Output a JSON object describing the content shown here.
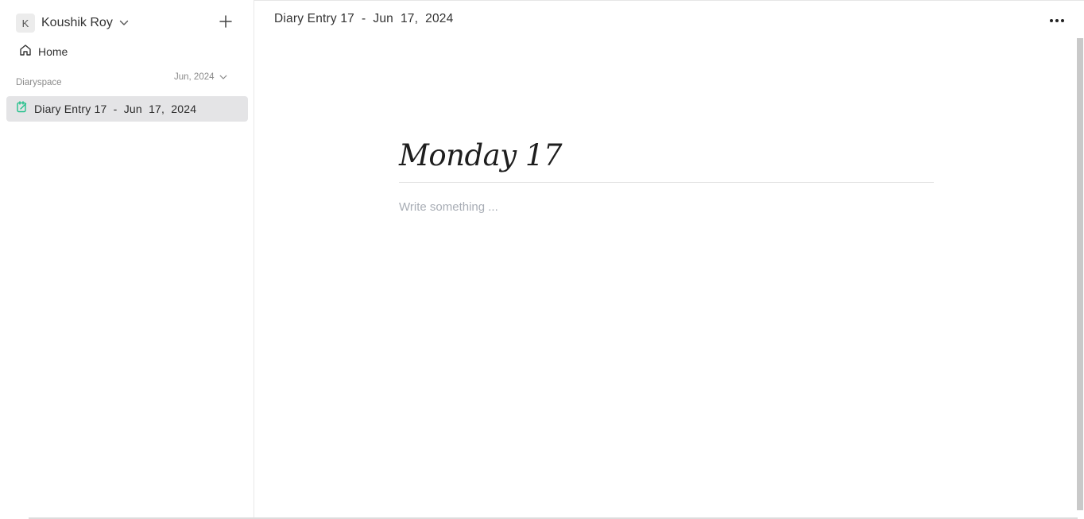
{
  "sidebar": {
    "user": {
      "initial": "K",
      "name": "Koushik Roy"
    },
    "home_label": "Home",
    "section_label": "Diaryspace",
    "month_filter": "Jun, 2024",
    "entries": [
      {
        "label": "Diary Entry 17  -  Jun  17,  2024",
        "icon": "diary-entry-icon",
        "selected": true
      }
    ]
  },
  "header": {
    "breadcrumb": "Diary Entry 17  -  Jun  17,  2024",
    "more_icon": "more-horizontal-icon"
  },
  "editor": {
    "title": "Monday 17",
    "placeholder": "Write something ..."
  },
  "colors": {
    "accent": "#22c08a",
    "selected_bg": "#e4e4e6"
  }
}
